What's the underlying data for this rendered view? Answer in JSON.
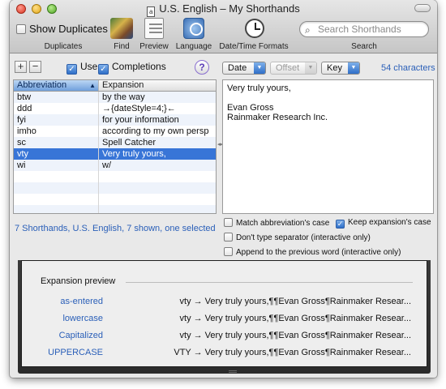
{
  "window": {
    "title": "U.S. English – My Shorthands",
    "title_icon_glyph": "a"
  },
  "toolbar": {
    "show_duplicates_label": "Show Duplicates",
    "duplicates_caption": "Duplicates",
    "find_caption": "Find",
    "preview_caption": "Preview",
    "language_caption": "Language",
    "datetime_caption": "Date/Time Formats",
    "search_placeholder": "Search Shorthands",
    "search_caption": "Search"
  },
  "controls": {
    "add_label": "+",
    "remove_label": "−",
    "use_label": "Use",
    "use_checked": true,
    "completions_label": "Completions",
    "completions_checked": true,
    "help_label": "?",
    "date_label": "Date",
    "offset_label": "Offset",
    "key_label": "Key",
    "characters_count": "54 characters"
  },
  "table": {
    "headers": [
      "Abbreviation",
      "Expansion"
    ],
    "rows": [
      {
        "abbr": "btw",
        "exp": "by the way"
      },
      {
        "abbr": "ddd",
        "exp": "→{dateStyle=4;}←"
      },
      {
        "abbr": "fyi",
        "exp": "for your information"
      },
      {
        "abbr": "imho",
        "exp": "according to my own persp"
      },
      {
        "abbr": "sc",
        "exp": "Spell Catcher"
      },
      {
        "abbr": "vty",
        "exp": "Very truly yours,"
      },
      {
        "abbr": "wi",
        "exp": "w/"
      }
    ],
    "selected_index": 5,
    "summary": "7 Shorthands, U.S. English, 7 shown, one selected"
  },
  "editor": {
    "lines": [
      "Very truly yours,",
      "",
      "Evan Gross",
      "Rainmaker Research Inc."
    ]
  },
  "options": {
    "match_case": "Match abbreviation's case",
    "match_case_checked": false,
    "keep_case": "Keep expansion's case",
    "keep_case_checked": true,
    "dont_type_separator": "Don't type separator (interactive only)",
    "dont_type_separator_checked": false,
    "append_previous": "Append to the previous word (interactive only)",
    "append_previous_checked": false
  },
  "preview": {
    "heading": "Expansion preview",
    "rows": [
      {
        "label": "as-entered",
        "text": "vty → Very truly yours,¶¶Evan Gross¶Rainmaker Resear..."
      },
      {
        "label": "lowercase",
        "text": "vty → Very truly yours,¶¶Evan Gross¶Rainmaker Resear..."
      },
      {
        "label": "Capitalized",
        "text": "vty → Very truly yours,¶¶Evan Gross¶Rainmaker Resear..."
      },
      {
        "label": "UPPERCASE",
        "text": "VTY → Very truly yours,¶¶Evan Gross¶Rainmaker Resear..."
      }
    ]
  },
  "icons": {
    "find": "books-icon",
    "preview": "document-icon",
    "language": "globe-icon",
    "datetime": "clock-icon",
    "search": "magnifier-icon"
  },
  "colors": {
    "accent": "#3875d7",
    "link": "#2a5fb8",
    "drawer": "#2b2b2b"
  }
}
